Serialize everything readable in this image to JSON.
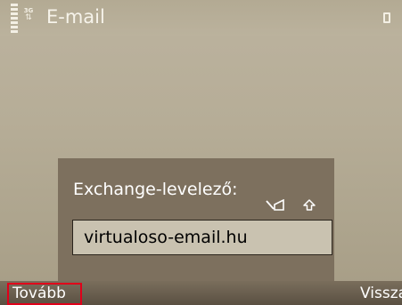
{
  "title_bar": {
    "title": "E-mail",
    "signal_icon": "signal-strength-icon",
    "network_icon": "3g-network-icon",
    "network_label": "3G",
    "battery_icon": "battery-icon"
  },
  "dialog": {
    "prompt": "Exchange-levelező:",
    "input_value": "virtualoso-email.hu",
    "input_mode_icons": [
      "abc-mode-icon",
      "shift-icon"
    ]
  },
  "softkeys": {
    "left": "Tovább",
    "right": "Vissza"
  },
  "colors": {
    "background": "#b4ab95",
    "dialog": "#7d705e",
    "input": "#c9c2b0",
    "focus_highlight": "#e0001a",
    "text_light": "#ffffff"
  }
}
